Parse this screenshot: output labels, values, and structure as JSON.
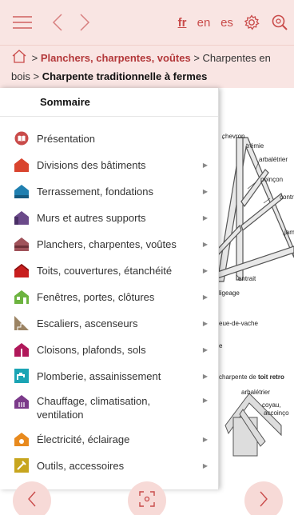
{
  "colors": {
    "accent": "#c94b4a",
    "bar_bg": "#f9e5e3"
  },
  "topbar": {
    "languages": [
      "fr",
      "en",
      "es"
    ],
    "active_language": "fr",
    "icons": [
      "menu-icon",
      "chevron-left-icon",
      "chevron-right-icon",
      "gear-icon",
      "search-icon"
    ]
  },
  "breadcrumb": {
    "sep": ">",
    "items": [
      "Planchers, charpentes, voûtes",
      "Charpentes en bois",
      "Charpente traditionnelle à fermes"
    ]
  },
  "summary": {
    "title": "Sommaire",
    "items": [
      {
        "label": "Présentation",
        "color": "#c94b4a",
        "icon": "book-icon",
        "arrow": false
      },
      {
        "label": "Divisions des bâtiments",
        "color": "#d9442e",
        "icon": "house-icon",
        "arrow": true
      },
      {
        "label": "Terrassement, fondations",
        "color": "#1f7fb0",
        "icon": "house-icon",
        "arrow": true
      },
      {
        "label": "Murs et autres supports",
        "color": "#6b4a8a",
        "icon": "house-icon",
        "arrow": true
      },
      {
        "label": "Planchers, charpentes, voûtes",
        "color": "#a0525a",
        "icon": "house-icon",
        "arrow": true
      },
      {
        "label": "Toits, couvertures, étanchéité",
        "color": "#c81e1e",
        "icon": "house-icon",
        "arrow": true
      },
      {
        "label": "Fenêtres, portes, clôtures",
        "color": "#6cb33f",
        "icon": "house-icon",
        "arrow": true
      },
      {
        "label": "Escaliers, ascenseurs",
        "color": "#9b8363",
        "icon": "stairs-icon",
        "arrow": true
      },
      {
        "label": "Cloisons, plafonds, sols",
        "color": "#b0185a",
        "icon": "house-icon",
        "arrow": true
      },
      {
        "label": "Plomberie, assainissement",
        "color": "#1aa4b4",
        "icon": "faucet-icon",
        "arrow": true
      },
      {
        "label": "Chauffage, climatisation, ventilation",
        "color": "#7b3a8a",
        "icon": "house-icon",
        "arrow": true
      },
      {
        "label": "Électricité, éclairage",
        "color": "#e88a1e",
        "icon": "house-icon",
        "arrow": true
      },
      {
        "label": "Outils, accessoires",
        "color": "#c7a51e",
        "icon": "tools-icon",
        "arrow": true
      }
    ]
  },
  "diagram": {
    "labels": [
      "chevron",
      "trémie",
      "arbalétrier",
      "poinçon",
      "contr",
      "jam",
      "entrait",
      "ligeage",
      "eue-de-vache",
      "e",
      "arbalétrier",
      "coyau,",
      "accoinço"
    ],
    "caption_prefix": "charpente de ",
    "caption_bold": "toit retro"
  },
  "bottom": {
    "icons": [
      "chevron-left-icon",
      "camera-focus-icon",
      "chevron-right-icon"
    ]
  }
}
